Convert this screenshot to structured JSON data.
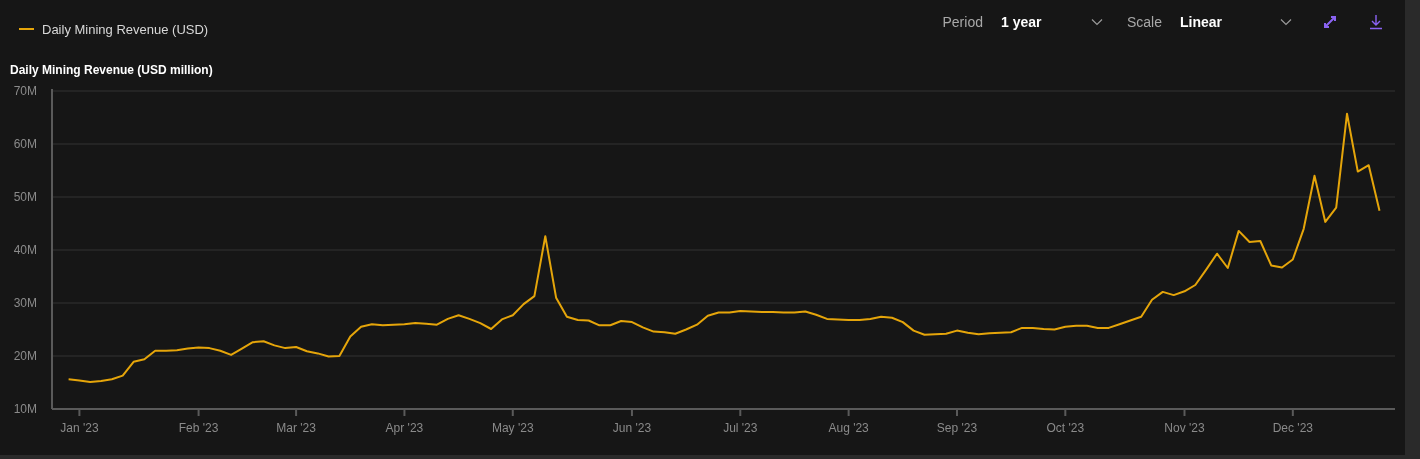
{
  "controls": [
    {
      "label": "Period",
      "value": "1 year"
    },
    {
      "label": "Scale",
      "value": "Linear"
    }
  ],
  "chart": {
    "chart_data": {
      "type": "line",
      "title": "Daily Mining Revenue (USD million)",
      "grid": true,
      "ylim": [
        10,
        70
      ],
      "yticks": [
        {
          "value": 10,
          "label": "10M"
        },
        {
          "value": 20,
          "label": "20M"
        },
        {
          "value": 30,
          "label": "30M"
        },
        {
          "value": 40,
          "label": "40M"
        },
        {
          "value": 50,
          "label": "50M"
        },
        {
          "value": 60,
          "label": "60M"
        },
        {
          "value": 70,
          "label": "70M"
        }
      ],
      "categories": [
        null,
        "Jan '23",
        null,
        null,
        null,
        null,
        null,
        null,
        null,
        null,
        null,
        null,
        "Feb '23",
        null,
        null,
        null,
        null,
        null,
        null,
        null,
        null,
        "Mar '23",
        null,
        null,
        null,
        null,
        null,
        null,
        null,
        null,
        null,
        "Apr '23",
        null,
        null,
        null,
        null,
        null,
        null,
        null,
        null,
        null,
        "May '23",
        null,
        null,
        null,
        null,
        null,
        null,
        null,
        null,
        null,
        null,
        "Jun '23",
        null,
        null,
        null,
        null,
        null,
        null,
        null,
        null,
        null,
        "Jul '23",
        null,
        null,
        null,
        null,
        null,
        null,
        null,
        null,
        null,
        "Aug '23",
        null,
        null,
        null,
        null,
        null,
        null,
        null,
        null,
        null,
        "Sep '23",
        null,
        null,
        null,
        null,
        null,
        null,
        null,
        null,
        null,
        "Oct '23",
        null,
        null,
        null,
        null,
        null,
        null,
        null,
        null,
        null,
        null,
        "Nov '23",
        null,
        null,
        null,
        null,
        null,
        null,
        null,
        null,
        null,
        "Dec '23",
        null,
        null,
        null,
        null,
        null,
        null,
        null,
        null
      ],
      "series": [
        {
          "name": "Daily Mining Revenue (USD)",
          "color": "#e5a50a",
          "values": [
            15.6,
            15.4,
            15.1,
            15.3,
            15.6,
            16.3,
            18.9,
            19.4,
            21,
            21,
            21.1,
            21.4,
            21.6,
            21.5,
            21,
            20.2,
            21.4,
            22.6,
            22.8,
            22,
            21.5,
            21.7,
            20.9,
            20.5,
            19.9,
            20,
            23.7,
            25.5,
            26,
            25.8,
            25.9,
            26,
            26.2,
            26.1,
            25.9,
            27,
            27.7,
            27,
            26.2,
            25.1,
            26.9,
            27.7,
            29.8,
            31.3,
            42.6,
            31,
            27.4,
            26.8,
            26.7,
            25.8,
            25.8,
            26.6,
            26.4,
            25.4,
            24.6,
            24.5,
            24.2,
            25,
            25.9,
            27.6,
            28.2,
            28.2,
            28.5,
            28.4,
            28.3,
            28.3,
            28.2,
            28.2,
            28.4,
            27.8,
            27,
            26.9,
            26.8,
            26.8,
            27,
            27.4,
            27.2,
            26.4,
            24.8,
            24,
            24.1,
            24.2,
            24.8,
            24.4,
            24.1,
            24.3,
            24.4,
            24.5,
            25.3,
            25.3,
            25.1,
            25,
            25.5,
            25.7,
            25.7,
            25.3,
            25.3,
            26,
            26.7,
            27.4,
            30.6,
            32.1,
            31.5,
            32.2,
            33.4,
            36.3,
            39.3,
            36.6,
            43.6,
            41.5,
            41.7,
            37.1,
            36.7,
            38.2,
            44,
            54,
            45.3,
            48,
            65.7,
            54.8,
            56,
            47.4
          ]
        }
      ]
    }
  }
}
